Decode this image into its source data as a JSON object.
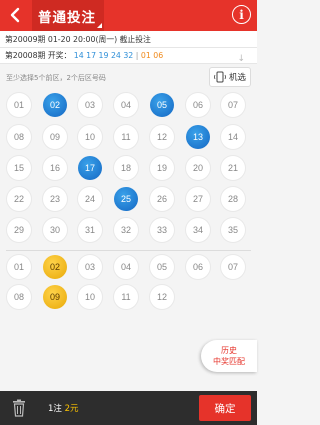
{
  "header": {
    "title": "普通投注",
    "back_icon": "chevron-left-icon",
    "info_label": "i",
    "bg_color": "#e6332a"
  },
  "draw_info": {
    "current": "第20009期 01-20 20:00(周一) 截止投注",
    "prev_prefix": "第20008期 开奖：",
    "prev_front": "14 17 19 24 32",
    "prev_sep": "|",
    "prev_back": "01 06"
  },
  "hint": "至少选择5个前区，2个后区号码",
  "machine_select_label": "机选",
  "front_balls": [
    {
      "num": "01",
      "selected": false
    },
    {
      "num": "02",
      "selected": true
    },
    {
      "num": "03",
      "selected": false
    },
    {
      "num": "04",
      "selected": false
    },
    {
      "num": "05",
      "selected": true
    },
    {
      "num": "06",
      "selected": false
    },
    {
      "num": "07",
      "selected": false
    },
    {
      "num": "08",
      "selected": false
    },
    {
      "num": "09",
      "selected": false
    },
    {
      "num": "10",
      "selected": false
    },
    {
      "num": "11",
      "selected": false
    },
    {
      "num": "12",
      "selected": false
    },
    {
      "num": "13",
      "selected": true
    },
    {
      "num": "14",
      "selected": false
    },
    {
      "num": "15",
      "selected": false
    },
    {
      "num": "16",
      "selected": false
    },
    {
      "num": "17",
      "selected": true
    },
    {
      "num": "18",
      "selected": false
    },
    {
      "num": "19",
      "selected": false
    },
    {
      "num": "20",
      "selected": false
    },
    {
      "num": "21",
      "selected": false
    },
    {
      "num": "22",
      "selected": false
    },
    {
      "num": "23",
      "selected": false
    },
    {
      "num": "24",
      "selected": false
    },
    {
      "num": "25",
      "selected": true
    },
    {
      "num": "26",
      "selected": false
    },
    {
      "num": "27",
      "selected": false
    },
    {
      "num": "28",
      "selected": false
    },
    {
      "num": "29",
      "selected": false
    },
    {
      "num": "30",
      "selected": false
    },
    {
      "num": "31",
      "selected": false
    },
    {
      "num": "32",
      "selected": false
    },
    {
      "num": "33",
      "selected": false
    },
    {
      "num": "34",
      "selected": false
    },
    {
      "num": "35",
      "selected": false
    }
  ],
  "back_balls": [
    {
      "num": "01",
      "selected": false
    },
    {
      "num": "02",
      "selected": true
    },
    {
      "num": "03",
      "selected": false
    },
    {
      "num": "04",
      "selected": false
    },
    {
      "num": "05",
      "selected": false
    },
    {
      "num": "06",
      "selected": false
    },
    {
      "num": "07",
      "selected": false
    },
    {
      "num": "08",
      "selected": false
    },
    {
      "num": "09",
      "selected": true
    },
    {
      "num": "10",
      "selected": false
    },
    {
      "num": "11",
      "selected": false
    },
    {
      "num": "12",
      "selected": false
    }
  ],
  "history_button": {
    "line1": "历史",
    "line2": "中奖匹配"
  },
  "footer": {
    "count_prefix": "1注",
    "amount": "2元",
    "confirm_label": "确定"
  }
}
